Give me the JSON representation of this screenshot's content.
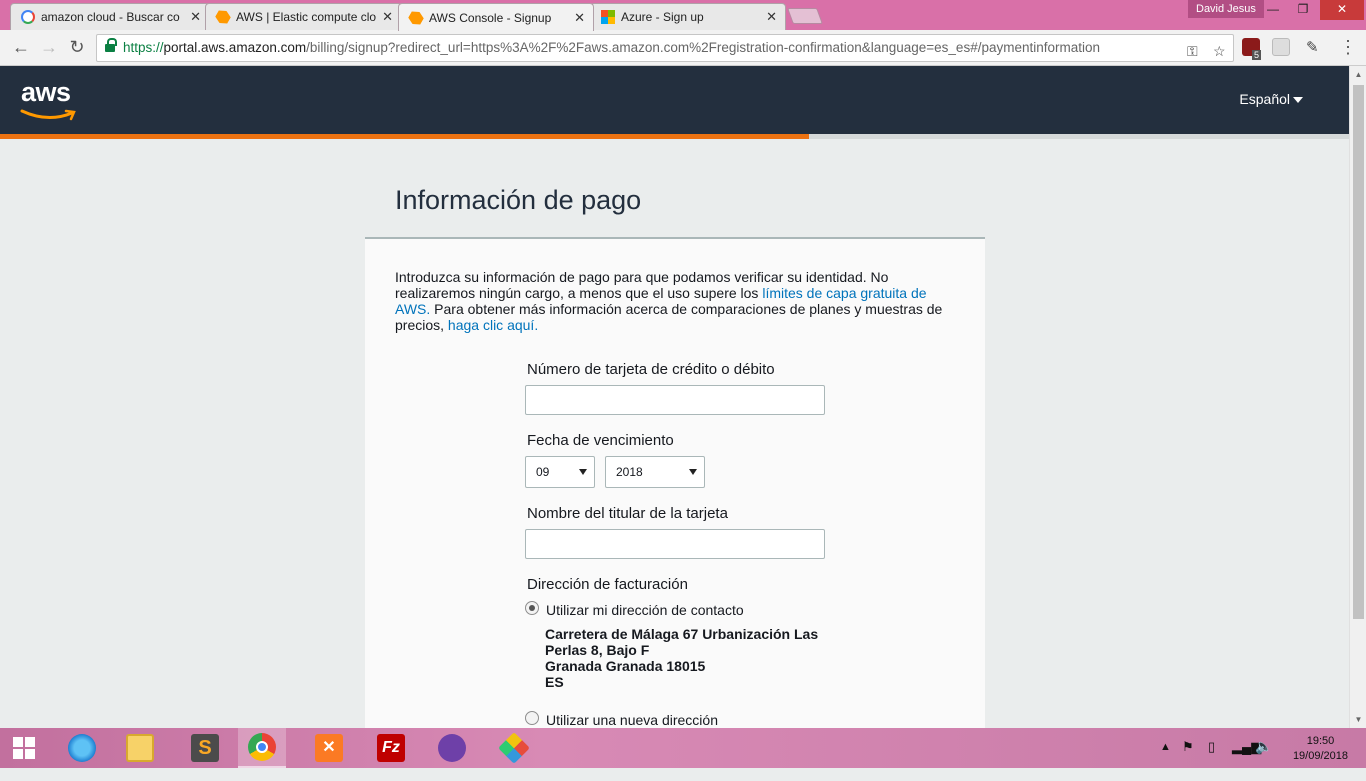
{
  "browser": {
    "tabs": [
      {
        "title": "amazon cloud - Buscar co",
        "icon": "google-icon",
        "active": false
      },
      {
        "title": "AWS | Elastic compute clo",
        "icon": "aws-icon",
        "active": false
      },
      {
        "title": "AWS Console - Signup",
        "icon": "aws-icon",
        "active": true
      },
      {
        "title": "Azure - Sign up",
        "icon": "microsoft-icon",
        "active": false
      }
    ],
    "profile_name": "David Jesus",
    "url_scheme": "https://",
    "url_host": "portal.aws.amazon.com",
    "url_rest": "/billing/signup?redirect_url=https%3A%2F%2Faws.amazon.com%2Fregistration-confirmation&language=es_es#/paymentinformation",
    "extension_badge": "5"
  },
  "header": {
    "logo": "aws",
    "language": "Español",
    "progress": 0.6
  },
  "form": {
    "title": "Información de pago",
    "intro_part1": "Introduzca su información de pago para que podamos verificar su identidad. No realizaremos ningún cargo, a menos que el uso supere los ",
    "intro_link1": "límites de capa gratuita de AWS.",
    "intro_part2": " Para obtener más información acerca de comparaciones de planes y muestras de precios, ",
    "intro_link2": "haga clic aquí.",
    "card_number_label": "Número de tarjeta de crédito o débito",
    "card_number_value": "",
    "expiry_label": "Fecha de vencimiento",
    "expiry_month": "09",
    "expiry_year": "2018",
    "holder_label": "Nombre del titular de la tarjeta",
    "holder_value": "",
    "billing_label": "Dirección de facturación",
    "option_contact": "Utilizar mi dirección de contacto",
    "address_lines": [
      "Carretera de Málaga 67 Urbanización Las",
      "Perlas 8, Bajo F",
      "Granada Granada 18015",
      "ES"
    ],
    "option_new": "Utilizar una nueva dirección"
  },
  "taskbar": {
    "apps": [
      "internet-explorer-icon",
      "file-explorer-icon",
      "sublime-text-icon",
      "chrome-icon",
      "xampp-icon",
      "filezilla-icon",
      "github-desktop-icon",
      "git-kraken-icon"
    ],
    "time": "19:50",
    "date": "19/09/2018"
  }
}
